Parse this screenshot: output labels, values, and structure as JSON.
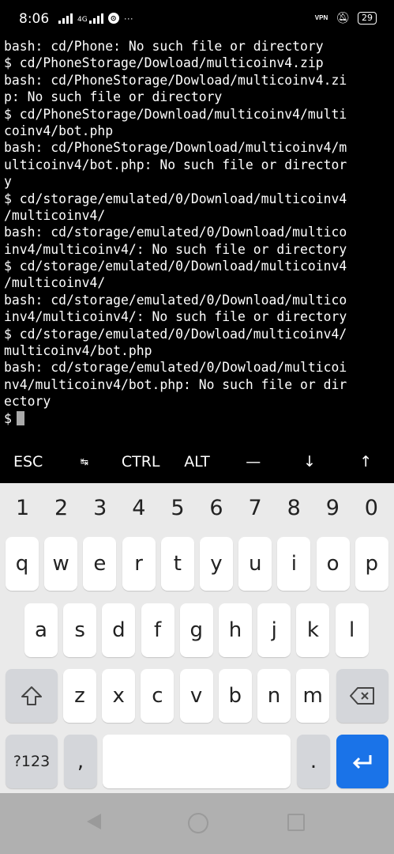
{
  "status_bar": {
    "time": "8:06",
    "network_label": "4G",
    "overflow_dots": "···",
    "vpn_label": "VPN",
    "battery": "29"
  },
  "terminal": {
    "lines": [
      "bash: cd/Phone: No such file or directory",
      "$ cd/PhoneStorage/Dowload/multicoinv4.zip",
      "bash: cd/PhoneStorage/Dowload/multicoinv4.zi",
      "p: No such file or directory",
      "$ cd/PhoneStorage/Download/multicoinv4/multi",
      "coinv4/bot.php",
      "bash: cd/PhoneStorage/Download/multicoinv4/m",
      "ulticoinv4/bot.php: No such file or director",
      "y",
      "$ cd/storage/emulated/0/Download/multicoinv4",
      "/multicoinv4/",
      "bash: cd/storage/emulated/0/Download/multico",
      "inv4/multicoinv4/: No such file or directory",
      "$ cd/storage/emulated/0/Download/multicoinv4",
      "/multicoinv4/",
      "bash: cd/storage/emulated/0/Download/multico",
      "inv4/multicoinv4/: No such file or directory",
      "$ cd/storage/emulated/0/Dowload/multicoinv4/",
      "multicoinv4/bot.php",
      "bash: cd/storage/emulated/0/Dowload/multicoi",
      "nv4/multicoinv4/bot.php: No such file or dir",
      "ectory"
    ],
    "prompt": "$"
  },
  "extra_keys": [
    "ESC",
    "↹",
    "CTRL",
    "ALT",
    "—",
    "↓",
    "↑"
  ],
  "keyboard": {
    "numbers": [
      "1",
      "2",
      "3",
      "4",
      "5",
      "6",
      "7",
      "8",
      "9",
      "0"
    ],
    "row1": [
      "q",
      "w",
      "e",
      "r",
      "t",
      "y",
      "u",
      "i",
      "o",
      "p"
    ],
    "row2": [
      "a",
      "s",
      "d",
      "f",
      "g",
      "h",
      "j",
      "k",
      "l"
    ],
    "row3": [
      "z",
      "x",
      "c",
      "v",
      "b",
      "n",
      "m"
    ],
    "symbols_label": "?123",
    "comma": ",",
    "period": "."
  }
}
